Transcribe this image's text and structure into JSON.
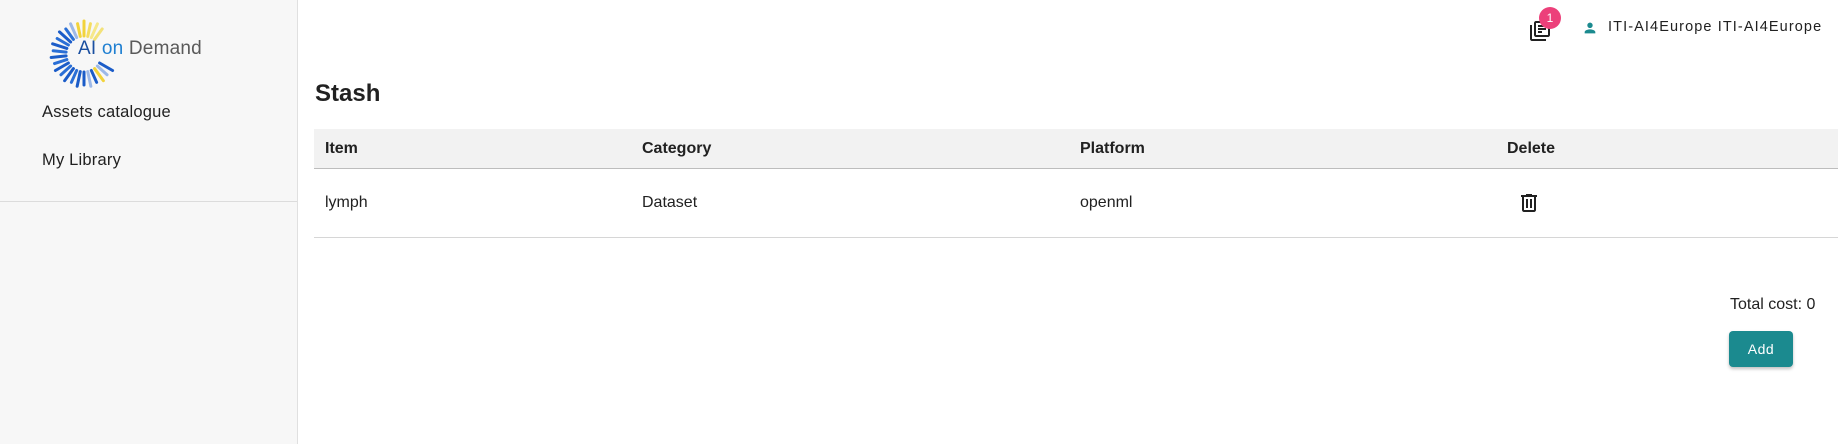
{
  "brand": {
    "logo_part1": "AI",
    "logo_part2": "on",
    "logo_part3": "Demand"
  },
  "sidebar": {
    "items": [
      {
        "label": "Assets catalogue"
      },
      {
        "label": "My Library"
      }
    ]
  },
  "header": {
    "stash_icon": "library-books-icon",
    "stash_badge_count": "1",
    "user_icon": "person-icon",
    "user_name": "ITI-AI4Europe ITI-AI4Europe"
  },
  "page": {
    "title": "Stash"
  },
  "table": {
    "columns": [
      "Item",
      "Category",
      "Platform",
      "Delete"
    ],
    "rows": [
      {
        "item": "lymph",
        "category": "Dataset",
        "platform": "openml",
        "delete_icon": "trash-icon"
      }
    ]
  },
  "footer": {
    "total_cost": "Total cost: 0",
    "add_label": "Add"
  },
  "colors": {
    "accent": "#1b8a8f",
    "badge": "#ec407a",
    "sidebar_bg": "#f7f7f7",
    "header_row_bg": "#f2f2f2"
  }
}
